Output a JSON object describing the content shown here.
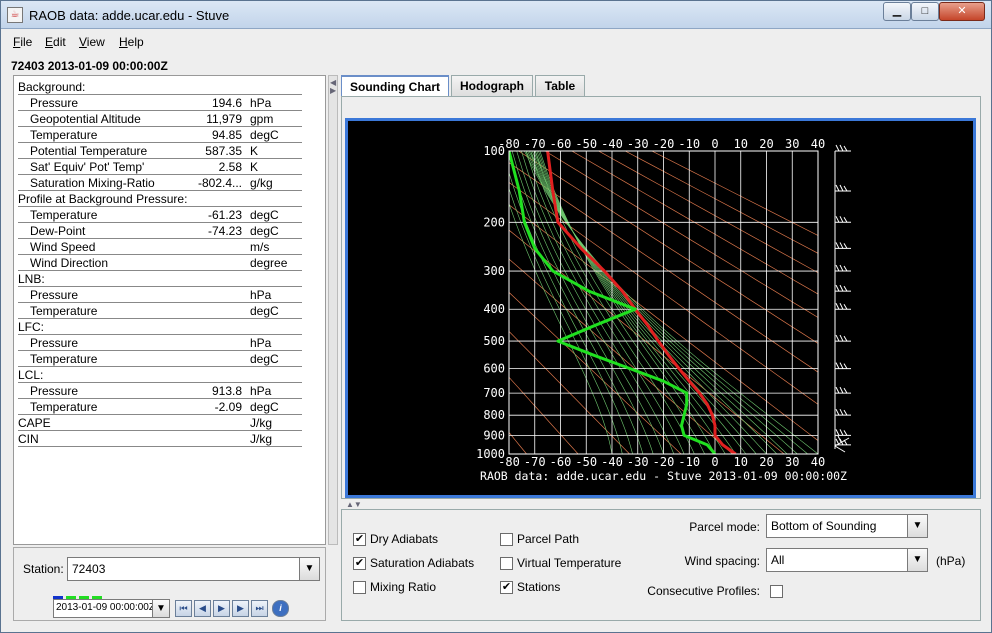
{
  "window": {
    "title": "RAOB data: adde.ucar.edu - Stuve",
    "minimize": "▁",
    "maximize": "□",
    "close": "✕"
  },
  "menu": {
    "file": "File",
    "edit": "Edit",
    "view": "View",
    "help": "Help"
  },
  "station_header": "72403 2013-01-09 00:00:00Z",
  "readout": [
    {
      "section": "Background:"
    },
    {
      "label": "Pressure",
      "value": "194.6",
      "unit": "hPa"
    },
    {
      "label": "Geopotential Altitude",
      "value": "11,979",
      "unit": "gpm"
    },
    {
      "label": "Temperature",
      "value": "94.85",
      "unit": "degC"
    },
    {
      "label": "Potential Temperature",
      "value": "587.35",
      "unit": "K"
    },
    {
      "label": "Sat' Equiv' Pot' Temp'",
      "value": "2.58",
      "unit": "K"
    },
    {
      "label": "Saturation Mixing-Ratio",
      "value": "-802.4...",
      "unit": "g/kg"
    },
    {
      "section": "Profile at Background Pressure:"
    },
    {
      "label": "Temperature",
      "value": "-61.23",
      "unit": "degC"
    },
    {
      "label": "Dew-Point",
      "value": "-74.23",
      "unit": "degC"
    },
    {
      "label": "Wind Speed",
      "value": "",
      "unit": "m/s"
    },
    {
      "label": "Wind Direction",
      "value": "",
      "unit": "degree"
    },
    {
      "section": "LNB:"
    },
    {
      "label": "Pressure",
      "value": "",
      "unit": "hPa"
    },
    {
      "label": "Temperature",
      "value": "",
      "unit": "degC"
    },
    {
      "section": "LFC:"
    },
    {
      "label": "Pressure",
      "value": "",
      "unit": "hPa"
    },
    {
      "label": "Temperature",
      "value": "",
      "unit": "degC"
    },
    {
      "section": "LCL:"
    },
    {
      "label": "Pressure",
      "value": "913.8",
      "unit": "hPa"
    },
    {
      "label": "Temperature",
      "value": "-2.09",
      "unit": "degC"
    },
    {
      "section": "CAPE",
      "unit": "J/kg"
    },
    {
      "section": "CIN",
      "unit": "J/kg"
    }
  ],
  "station": {
    "label": "Station:",
    "value": "72403"
  },
  "time": {
    "value": "2013-01-09 00:00:00Z"
  },
  "animation": {
    "first": "⏮",
    "prev": "◀",
    "play": "▶",
    "next": "▶",
    "last": "⏭",
    "info": "i"
  },
  "tabs": {
    "sounding_chart": "Sounding Chart",
    "hodograph": "Hodograph",
    "table": "Table"
  },
  "chart_data": {
    "type": "line",
    "caption": "RAOB data: adde.ucar.edu - Stuve 2013-01-09 00:00:00Z",
    "x_ticks": [
      -80,
      -70,
      -60,
      -50,
      -40,
      -30,
      -20,
      -10,
      0,
      10,
      20,
      30,
      40
    ],
    "y_ticks": [
      100,
      200,
      300,
      400,
      500,
      600,
      700,
      800,
      900,
      1000
    ],
    "xlim": [
      -80,
      40
    ],
    "ylim": [
      1000,
      100
    ],
    "y_scale": "stuve",
    "series": [
      {
        "name": "temperature",
        "color": "#e02020",
        "pressure": [
          100,
          150,
          200,
          250,
          300,
          350,
          400,
          450,
          500,
          550,
          600,
          650,
          700,
          750,
          800,
          850,
          900,
          950,
          1000
        ],
        "values": [
          -65,
          -63,
          -61,
          -52,
          -43,
          -36,
          -31,
          -26,
          -22,
          -18,
          -14,
          -10,
          -6,
          -3,
          -1,
          0,
          0,
          3,
          8
        ]
      },
      {
        "name": "dewpoint",
        "color": "#20e020",
        "pressure": [
          100,
          150,
          200,
          250,
          300,
          350,
          400,
          450,
          500,
          550,
          600,
          650,
          700,
          750,
          800,
          850,
          900,
          950,
          1000
        ],
        "values": [
          -80,
          -76,
          -74,
          -70,
          -63,
          -49,
          -31,
          -47,
          -61,
          -47,
          -33,
          -20,
          -11,
          -11,
          -12,
          -13,
          -12,
          -3,
          0
        ]
      }
    ]
  },
  "controls": {
    "dry_adiabats": {
      "label": "Dry Adiabats",
      "checked": true
    },
    "saturation_adiabats": {
      "label": "Saturation Adiabats",
      "checked": true
    },
    "mixing_ratio": {
      "label": "Mixing Ratio",
      "checked": false
    },
    "parcel_path": {
      "label": "Parcel Path",
      "checked": false
    },
    "virtual_temperature": {
      "label": "Virtual Temperature",
      "checked": false
    },
    "stations": {
      "label": "Stations",
      "checked": true
    },
    "parcel_mode_label": "Parcel mode:",
    "parcel_mode_value": "Bottom of Sounding",
    "wind_spacing_label": "Wind spacing:",
    "wind_spacing_value": "All",
    "wind_spacing_unit": "(hPa)",
    "consecutive_profiles_label": "Consecutive Profiles:",
    "consecutive_profiles_checked": false,
    "check_glyph": "✔"
  }
}
